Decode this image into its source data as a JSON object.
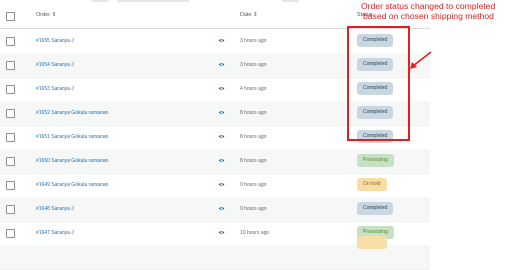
{
  "header": {
    "order_label": "Order ⇕",
    "date_label": "Date ⇕",
    "status_label": "Status"
  },
  "rows": [
    {
      "order": "#1655 Saranya J",
      "date": "3 hours ago",
      "status": "Completed"
    },
    {
      "order": "#1654 Saranya J",
      "date": "3 hours ago",
      "status": "Completed"
    },
    {
      "order": "#1653 Saranya J",
      "date": "4 hours ago",
      "status": "Completed"
    },
    {
      "order": "#1652 Saranya Gokula ramanan",
      "date": "8 hours ago",
      "status": "Completed"
    },
    {
      "order": "#1651 Saranya Gokula ramanan",
      "date": "8 hours ago",
      "status": "Completed"
    },
    {
      "order": "#1650 Saranya Gokula ramanan",
      "date": "8 hours ago",
      "status": "Processing"
    },
    {
      "order": "#1649 Saranya Gokula ramanan",
      "date": "9 hours ago",
      "status": "On hold"
    },
    {
      "order": "#1648 Saranya J",
      "date": "9 hours ago",
      "status": "Completed"
    },
    {
      "order": "#1647 Saranya J",
      "date": "10 hours ago",
      "status": "Processing"
    }
  ],
  "annotation": {
    "text_line1": "Order status  changed to completed",
    "text_line2": "based on chosen shipping method"
  },
  "colors": {
    "completed_bg": "#c8d7e1",
    "completed_fg": "#2e4453",
    "processing_bg": "#c6e1c6",
    "processing_fg": "#5b841b",
    "onhold_bg": "#f8dda7",
    "onhold_fg": "#94660c",
    "annotation": "#e02020"
  }
}
